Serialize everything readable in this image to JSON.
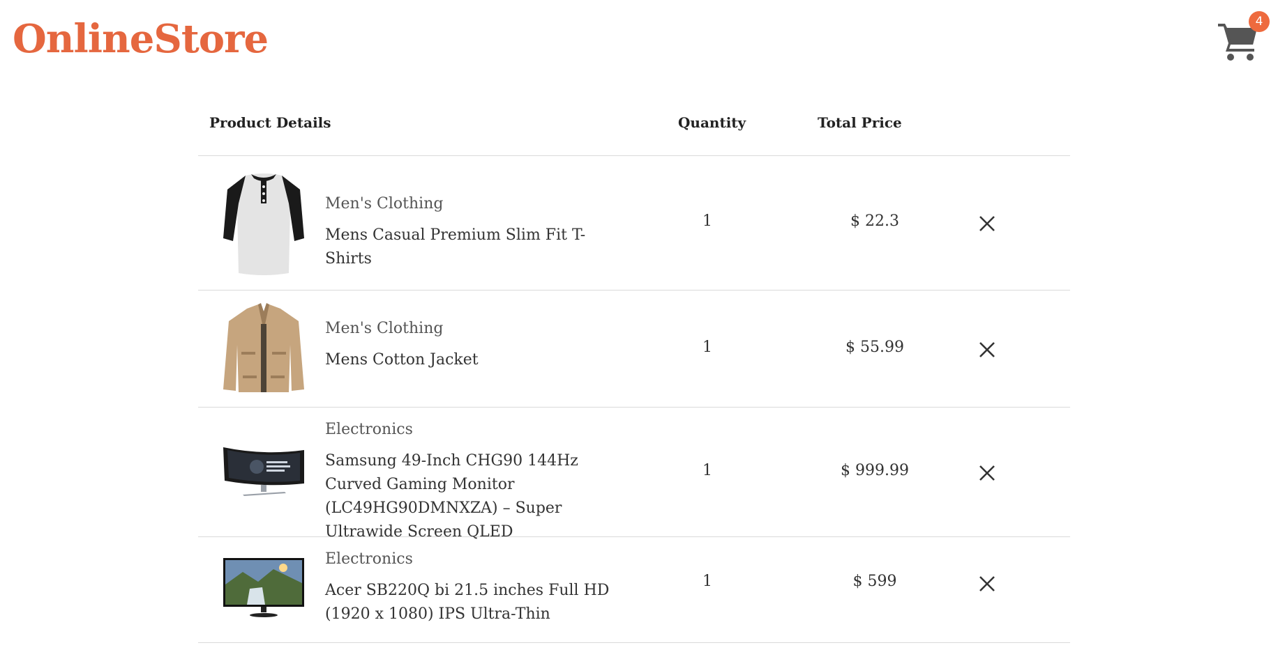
{
  "header": {
    "brand": "OnlineStore",
    "cart_count": "4"
  },
  "table": {
    "columns": {
      "product": "Product Details",
      "quantity": "Quantity",
      "price": "Total Price"
    },
    "rows": [
      {
        "category": "Men's Clothing",
        "name": "Mens Casual Premium Slim Fit T-Shirts",
        "quantity": "1",
        "price": "$ 22.3",
        "image": "tshirt-image"
      },
      {
        "category": "Men's Clothing",
        "name": "Mens Cotton Jacket",
        "quantity": "1",
        "price": "$ 55.99",
        "image": "jacket-image"
      },
      {
        "category": "Electronics",
        "name": "Samsung 49-Inch CHG90 144Hz Curved Gaming Monitor (LC49HG90DMNXZA) – Super Ultrawide Screen QLED",
        "quantity": "1",
        "price": "$ 999.99",
        "image": "curved-monitor-image"
      },
      {
        "category": "Electronics",
        "name": "Acer SB220Q bi 21.5 inches Full HD (1920 x 1080) IPS Ultra-Thin",
        "quantity": "1",
        "price": "$ 599",
        "image": "monitor-image"
      }
    ]
  },
  "icons": {
    "cart": "shopping-cart-icon",
    "remove": "close-icon"
  },
  "colors": {
    "brand": "#e5673f",
    "badge": "#ee6a3e",
    "text": "#333333",
    "divider": "#d9d9d9"
  }
}
